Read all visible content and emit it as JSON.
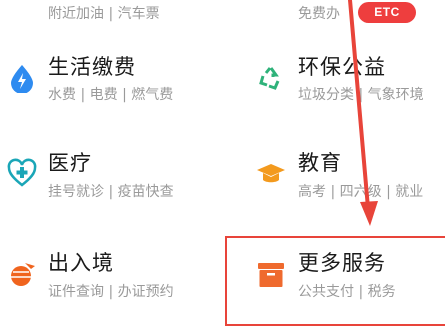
{
  "top": {
    "left_sub": "附近加油 | 汽车票",
    "right_sub": "免费办",
    "badge": "ETC"
  },
  "services": [
    {
      "title": "生活缴费",
      "sub": "水费 | 电费 | 燃气费",
      "icon": "water-drop-icon",
      "color": "#2e8bf0"
    },
    {
      "title": "环保公益",
      "sub": "垃圾分类 | 气象环境",
      "icon": "recycle-icon",
      "color": "#2fb27a"
    },
    {
      "title": "医疗",
      "sub": "挂号就诊 | 疫苗快查",
      "icon": "medical-cross-icon",
      "color": "#1aa6b7"
    },
    {
      "title": "教育",
      "sub": "高考 | 四六级 | 就业",
      "icon": "graduation-cap-icon",
      "color": "#f39a1e"
    },
    {
      "title": "出入境",
      "sub": "证件查询 | 办证预约",
      "icon": "globe-plane-icon",
      "color": "#f0641e"
    },
    {
      "title": "更多服务",
      "sub": "公共支付 | 税务",
      "icon": "box-icon",
      "color": "#ef6a2e"
    }
  ],
  "colors": {
    "annotation": "#e8443a"
  }
}
